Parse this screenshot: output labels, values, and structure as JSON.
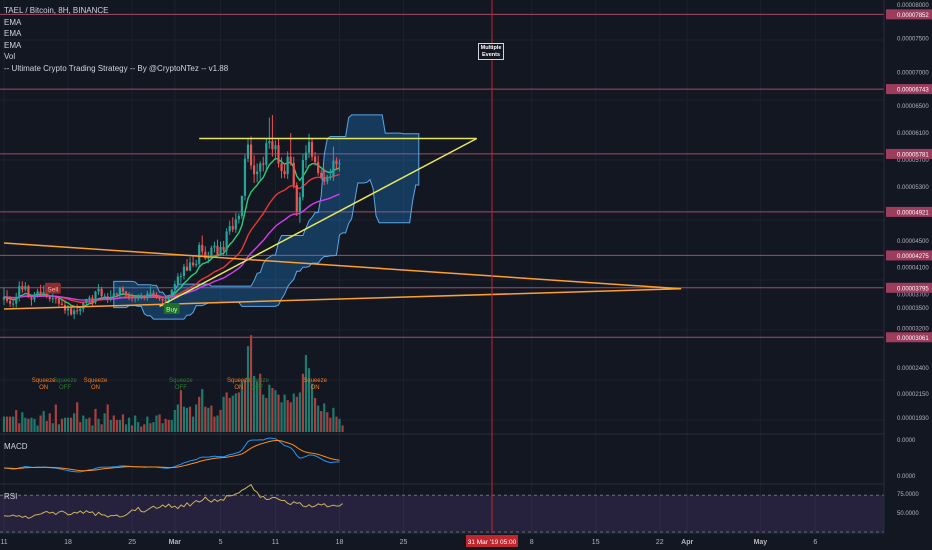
{
  "legend": {
    "symbol": "TAEL / Bitcoin, 8H, BINANCE",
    "indicators": [
      "EMA",
      "EMA",
      "EMA",
      "Vol",
      "-- Ultimate Crypto Trading Strategy -- By @CryptoNTez -- v1.88"
    ]
  },
  "events_badge": "Multiple Events",
  "panes": {
    "macd": "MACD",
    "rsi": "RSI"
  },
  "x_ticks": [
    {
      "label": "11",
      "i": 0
    },
    {
      "label": "18",
      "i": 21
    },
    {
      "label": "25",
      "i": 42
    },
    {
      "label": "Mar",
      "i": 56
    },
    {
      "label": "5",
      "i": 71
    },
    {
      "label": "11",
      "i": 89
    },
    {
      "label": "18",
      "i": 110
    },
    {
      "label": "25",
      "i": 131
    },
    {
      "label": "8",
      "i": 173
    },
    {
      "label": "15",
      "i": 194
    },
    {
      "label": "22",
      "i": 215
    },
    {
      "label": "Apr",
      "i": 224
    },
    {
      "label": "May",
      "i": 248
    },
    {
      "label": "6",
      "i": 266
    }
  ],
  "crosshair_label": "31 Mar '19 05:00",
  "chart_data": {
    "type": "candlestick",
    "symbol": "TAEL/BTC",
    "interval": "8H",
    "exchange": "BINANCE",
    "price_axis_ticks": [
      "0.00008000",
      "0.00007500",
      "0.00007000",
      "0.00006500",
      "0.00006100",
      "0.00005700",
      "0.00005300",
      "0.00004900",
      "0.00004500",
      "0.00004100",
      "0.00003700",
      "0.00003500",
      "0.00003200",
      "0.00002900",
      "0.00002650",
      "0.00002400",
      "0.00002150",
      "0.00001930"
    ],
    "horizontal_levels": [
      "0.00007852",
      "0.00006743",
      "0.00005781",
      "0.00004921",
      "0.00004275",
      "0.00003795",
      "0.00003061"
    ],
    "ylim": [
      3.05e-05,
      8.05e-05
    ],
    "trend_lines": [
      {
        "color": "#e6e65c",
        "from": [
          51,
          3.52e-05
        ],
        "to": [
          155,
          6.01e-05
        ]
      },
      {
        "color": "#e6e65c",
        "from": [
          64,
          6.01e-05
        ],
        "to": [
          155,
          6.01e-05
        ]
      },
      {
        "color": "#ff9f2e",
        "from": [
          0,
          4.46e-05
        ],
        "to": [
          222,
          3.78e-05
        ]
      },
      {
        "color": "#ff9f2e",
        "from": [
          0,
          3.48e-05
        ],
        "to": [
          222,
          3.78e-05
        ]
      }
    ],
    "signals": [
      {
        "label": "Sell",
        "i": 16,
        "price": 3.78e-05
      },
      {
        "label": "Buy",
        "i": 55,
        "price": 3.48e-05
      }
    ],
    "squeeze_labels": [
      {
        "text": "Squeeze ON",
        "i": 13
      },
      {
        "text": "Squeeze OFF",
        "i": 20
      },
      {
        "text": "Squeeze ON",
        "i": 30
      },
      {
        "text": "Squeeze OFF",
        "i": 58
      },
      {
        "text": "Squeeze ON",
        "i": 77
      },
      {
        "text": "Squeeze OFF",
        "i": 83
      },
      {
        "text": "Squeeze ON",
        "i": 102
      }
    ],
    "candles": [
      [
        3.62e-05,
        3.79e-05,
        3.54e-05,
        3.66e-05
      ],
      [
        3.66e-05,
        3.76e-05,
        3.57e-05,
        3.6e-05
      ],
      [
        3.6e-05,
        3.67e-05,
        3.51e-05,
        3.56e-05
      ],
      [
        3.56e-05,
        3.63e-05,
        3.5e-05,
        3.56e-05
      ],
      [
        3.56e-05,
        3.72e-05,
        3.5e-05,
        3.66e-05
      ],
      [
        3.66e-05,
        3.89e-05,
        3.59e-05,
        3.82e-05
      ],
      [
        3.82e-05,
        3.89e-05,
        3.72e-05,
        3.77e-05
      ],
      [
        3.77e-05,
        3.88e-05,
        3.74e-05,
        3.82e-05
      ],
      [
        3.82e-05,
        3.84e-05,
        3.65e-05,
        3.65e-05
      ],
      [
        3.65e-05,
        3.69e-05,
        3.53e-05,
        3.62e-05
      ],
      [
        3.62e-05,
        3.73e-05,
        3.58e-05,
        3.69e-05
      ],
      [
        3.69e-05,
        3.78e-05,
        3.65e-05,
        3.74e-05
      ],
      [
        3.74e-05,
        3.84e-05,
        3.67e-05,
        3.68e-05
      ],
      [
        3.68e-05,
        3.83e-05,
        3.66e-05,
        3.73e-05
      ],
      [
        3.73e-05,
        3.83e-05,
        3.64e-05,
        3.66e-05
      ],
      [
        3.66e-05,
        3.67e-05,
        3.59e-05,
        3.63e-05
      ],
      [
        3.63e-05,
        3.73e-05,
        3.57e-05,
        3.64e-05
      ],
      [
        3.64e-05,
        3.67e-05,
        3.56e-05,
        3.63e-05
      ],
      [
        3.63e-05,
        3.66e-05,
        3.52e-05,
        3.56e-05
      ],
      [
        3.56e-05,
        3.64e-05,
        3.53e-05,
        3.54e-05
      ],
      [
        3.54e-05,
        3.61e-05,
        3.41e-05,
        3.46e-05
      ],
      [
        3.46e-05,
        3.54e-05,
        3.38e-05,
        3.49e-05
      ],
      [
        3.49e-05,
        3.52e-05,
        3.38e-05,
        3.4e-05
      ],
      [
        3.4e-05,
        3.49e-05,
        3.33e-05,
        3.46e-05
      ],
      [
        3.46e-05,
        3.55e-05,
        3.4e-05,
        3.45e-05
      ],
      [
        3.45e-05,
        3.51e-05,
        3.39e-05,
        3.48e-05
      ],
      [
        3.48e-05,
        3.59e-05,
        3.43e-05,
        3.57e-05
      ],
      [
        3.57e-05,
        3.63e-05,
        3.54e-05,
        3.63e-05
      ],
      [
        3.63e-05,
        3.68e-05,
        3.55e-05,
        3.65e-05
      ],
      [
        3.65e-05,
        3.69e-05,
        3.53e-05,
        3.58e-05
      ],
      [
        3.58e-05,
        3.75e-05,
        3.55e-05,
        3.74e-05
      ],
      [
        3.74e-05,
        3.85e-05,
        3.69e-05,
        3.78e-05
      ],
      [
        3.78e-05,
        3.81e-05,
        3.63e-05,
        3.67e-05
      ],
      [
        3.67e-05,
        3.71e-05,
        3.63e-05,
        3.67e-05
      ],
      [
        3.67e-05,
        3.72e-05,
        3.57e-05,
        3.65e-05
      ],
      [
        3.65e-05,
        3.76e-05,
        3.59e-05,
        3.65e-05
      ],
      [
        3.65e-05,
        3.75e-05,
        3.61e-05,
        3.71e-05
      ],
      [
        3.71e-05,
        3.72e-05,
        3.66e-05,
        3.7e-05
      ],
      [
        3.7e-05,
        3.81e-05,
        3.65e-05,
        3.79e-05
      ],
      [
        3.79e-05,
        3.82e-05,
        3.71e-05,
        3.74e-05
      ],
      [
        3.74e-05,
        3.75e-05,
        3.66e-05,
        3.68e-05
      ],
      [
        3.68e-05,
        3.73e-05,
        3.61e-05,
        3.66e-05
      ],
      [
        3.66e-05,
        3.71e-05,
        3.59e-05,
        3.64e-05
      ],
      [
        3.64e-05,
        3.68e-05,
        3.58e-05,
        3.66e-05
      ],
      [
        3.66e-05,
        3.7e-05,
        3.6e-05,
        3.66e-05
      ],
      [
        3.66e-05,
        3.72e-05,
        3.62e-05,
        3.68e-05
      ],
      [
        3.68e-05,
        3.69e-05,
        3.61e-05,
        3.64e-05
      ],
      [
        3.64e-05,
        3.75e-05,
        3.6e-05,
        3.71e-05
      ],
      [
        3.71e-05,
        3.82e-05,
        3.66e-05,
        3.72e-05
      ],
      [
        3.72e-05,
        3.76e-05,
        3.65e-05,
        3.69e-05
      ],
      [
        3.69e-05,
        3.73e-05,
        3.63e-05,
        3.66e-05
      ],
      [
        3.66e-05,
        3.67e-05,
        3.6e-05,
        3.63e-05
      ],
      [
        3.63e-05,
        3.64e-05,
        3.52e-05,
        3.61e-05
      ],
      [
        3.61e-05,
        3.65e-05,
        3.52e-05,
        3.59e-05
      ],
      [
        3.59e-05,
        3.69e-05,
        3.54e-05,
        3.67e-05
      ],
      [
        3.67e-05,
        3.77e-05,
        3.63e-05,
        3.77e-05
      ],
      [
        3.77e-05,
        3.9e-05,
        3.7e-05,
        3.85e-05
      ],
      [
        3.85e-05,
        4.01e-05,
        3.81e-05,
        3.96e-05
      ],
      [
        3.96e-05,
        4.02e-05,
        3.87e-05,
        3.97e-05
      ],
      [
        3.97e-05,
        4.15e-05,
        3.92e-05,
        4.11e-05
      ],
      [
        4.11e-05,
        4.22e-05,
        4.04e-05,
        4.05e-05
      ],
      [
        4.05e-05,
        4.25e-05,
        4.04e-05,
        4.17e-05
      ],
      [
        4.17e-05,
        4.28e-05,
        4.1e-05,
        4.13e-05
      ],
      [
        4.13e-05,
        4.21e-05,
        4.1e-05,
        4.15e-05
      ],
      [
        4.15e-05,
        4.47e-05,
        4.11e-05,
        4.43e-05
      ],
      [
        4.43e-05,
        4.57e-05,
        4.28e-05,
        4.33e-05
      ],
      [
        4.33e-05,
        4.41e-05,
        4.21e-05,
        4.23e-05
      ],
      [
        4.23e-05,
        4.33e-05,
        4.16e-05,
        4.26e-05
      ],
      [
        4.26e-05,
        4.42e-05,
        4.22e-05,
        4.39e-05
      ],
      [
        4.39e-05,
        4.48e-05,
        4.32e-05,
        4.42e-05
      ],
      [
        4.42e-05,
        4.51e-05,
        4.26e-05,
        4.28e-05
      ],
      [
        4.28e-05,
        4.48e-05,
        4.27e-05,
        4.4e-05
      ],
      [
        4.4e-05,
        4.49e-05,
        4.27e-05,
        4.35e-05
      ],
      [
        4.35e-05,
        4.68e-05,
        4.28e-05,
        4.63e-05
      ],
      [
        4.63e-05,
        4.79e-05,
        4.58e-05,
        4.71e-05
      ],
      [
        4.71e-05,
        4.84e-05,
        4.62e-05,
        4.66e-05
      ],
      [
        4.66e-05,
        4.91e-05,
        4.61e-05,
        4.81e-05
      ],
      [
        4.81e-05,
        4.9e-05,
        4.75e-05,
        4.86e-05
      ],
      [
        4.86e-05,
        5.16e-05,
        4.82e-05,
        5.16e-05
      ],
      [
        5.16e-05,
        5.77e-05,
        5.09e-05,
        5.71e-05
      ],
      [
        5.71e-05,
        6.01e-05,
        5.66e-05,
        5.92e-05
      ],
      [
        5.92e-05,
        6.04e-05,
        5.55e-05,
        5.61e-05
      ],
      [
        5.61e-05,
        5.76e-05,
        5.35e-05,
        5.48e-05
      ],
      [
        5.48e-05,
        5.64e-05,
        5.36e-05,
        5.52e-05
      ],
      [
        5.52e-05,
        5.67e-05,
        5.4e-05,
        5.64e-05
      ],
      [
        5.64e-05,
        5.74e-05,
        5.52e-05,
        5.62e-05
      ],
      [
        5.62e-05,
        6.01e-05,
        5.54e-05,
        5.94e-05
      ],
      [
        5.94e-05,
        6.32e-05,
        5.86e-05,
        5.97e-05
      ],
      [
        5.97e-05,
        6.36e-05,
        5.74e-05,
        5.85e-05
      ],
      [
        5.85e-05,
        5.98e-05,
        5.69e-05,
        5.91e-05
      ],
      [
        5.91e-05,
        6.01e-05,
        5.58e-05,
        5.64e-05
      ],
      [
        5.64e-05,
        5.73e-05,
        5.42e-05,
        5.53e-05
      ],
      [
        5.53e-05,
        5.63e-05,
        5.42e-05,
        5.48e-05
      ],
      [
        5.48e-05,
        5.82e-05,
        5.41e-05,
        5.74e-05
      ],
      [
        5.74e-05,
        6.09e-05,
        5.61e-05,
        5.65e-05
      ],
      [
        5.65e-05,
        5.74e-05,
        5.27e-05,
        5.32e-05
      ],
      [
        5.32e-05,
        5.36e-05,
        4.86e-05,
        4.92e-05
      ],
      [
        4.92e-05,
        5.21e-05,
        4.76e-05,
        5.14e-05
      ],
      [
        5.14e-05,
        5.78e-05,
        5.09e-05,
        5.69e-05
      ],
      [
        5.69e-05,
        5.91e-05,
        5.57e-05,
        5.8e-05
      ],
      [
        5.8e-05,
        6.08e-05,
        5.72e-05,
        5.96e-05
      ],
      [
        5.96e-05,
        6.02e-05,
        5.68e-05,
        5.74e-05
      ],
      [
        5.74e-05,
        5.81e-05,
        5.61e-05,
        5.66e-05
      ],
      [
        5.66e-05,
        5.76e-05,
        5.46e-05,
        5.5e-05
      ],
      [
        5.5e-05,
        5.55e-05,
        5.4e-05,
        5.43e-05
      ],
      [
        5.43e-05,
        5.56e-05,
        5.32e-05,
        5.37e-05
      ],
      [
        5.37e-05,
        5.47e-05,
        5.33e-05,
        5.44e-05
      ],
      [
        5.44e-05,
        5.56e-05,
        5.39e-05,
        5.45e-05
      ],
      [
        5.45e-05,
        5.89e-05,
        5.38e-05,
        5.68e-05
      ],
      [
        5.68e-05,
        5.73e-05,
        5.54e-05,
        5.63e-05
      ],
      [
        5.63e-05,
        5.7e-05,
        5.52e-05,
        5.64e-05
      ]
    ],
    "volume": [
      [
        1.4,
        1
      ],
      [
        1.4,
        0
      ],
      [
        1.4,
        0
      ],
      [
        1.4,
        1
      ],
      [
        2.0,
        0
      ],
      [
        0.8,
        0
      ],
      [
        1.8,
        1
      ],
      [
        1.3,
        1
      ],
      [
        1.2,
        0
      ],
      [
        1.3,
        1
      ],
      [
        1.2,
        1
      ],
      [
        0.6,
        1
      ],
      [
        1.5,
        0
      ],
      [
        1.9,
        1
      ],
      [
        1.0,
        0
      ],
      [
        1.7,
        0
      ],
      [
        0.8,
        1
      ],
      [
        2.5,
        0
      ],
      [
        0.7,
        1
      ],
      [
        1.2,
        0
      ],
      [
        1.3,
        1
      ],
      [
        1.3,
        1
      ],
      [
        1.3,
        0
      ],
      [
        1.7,
        1
      ],
      [
        2.7,
        0
      ],
      [
        0.9,
        0
      ],
      [
        1.5,
        1
      ],
      [
        1.2,
        1
      ],
      [
        1.3,
        0
      ],
      [
        0.6,
        1
      ],
      [
        2.1,
        0
      ],
      [
        1.2,
        1
      ],
      [
        0.7,
        0
      ],
      [
        1.7,
        1
      ],
      [
        2.5,
        0
      ],
      [
        1.1,
        1
      ],
      [
        1.5,
        0
      ],
      [
        1.1,
        0
      ],
      [
        1.1,
        1
      ],
      [
        1.6,
        0
      ],
      [
        0.7,
        1
      ],
      [
        1.3,
        1
      ],
      [
        0.6,
        0
      ],
      [
        1.5,
        1
      ],
      [
        0.9,
        1
      ],
      [
        0.5,
        0
      ],
      [
        0.7,
        0
      ],
      [
        1.4,
        1
      ],
      [
        0.8,
        0
      ],
      [
        0.9,
        1
      ],
      [
        1.5,
        1
      ],
      [
        1.6,
        0
      ],
      [
        0.8,
        1
      ],
      [
        1.2,
        0
      ],
      [
        1.1,
        0
      ],
      [
        1.1,
        1
      ],
      [
        2.0,
        1
      ],
      [
        2.5,
        1
      ],
      [
        3.8,
        0
      ],
      [
        2.3,
        1
      ],
      [
        2.2,
        1
      ],
      [
        2.3,
        0
      ],
      [
        1.4,
        1
      ],
      [
        2.5,
        1
      ],
      [
        3.2,
        0
      ],
      [
        3.9,
        1
      ],
      [
        2.3,
        0
      ],
      [
        2.2,
        1
      ],
      [
        2.4,
        0
      ],
      [
        1.4,
        0
      ],
      [
        1.5,
        1
      ],
      [
        2.0,
        0
      ],
      [
        3.2,
        1
      ],
      [
        3.6,
        0
      ],
      [
        3.1,
        0
      ],
      [
        3.3,
        1
      ],
      [
        3.5,
        1
      ],
      [
        3.6,
        0
      ],
      [
        4.6,
        1
      ],
      [
        4.8,
        0
      ],
      [
        7.8,
        1
      ],
      [
        8.8,
        0
      ],
      [
        5.1,
        1
      ],
      [
        4.6,
        1
      ],
      [
        5.3,
        0
      ],
      [
        3.4,
        1
      ],
      [
        3.1,
        0
      ],
      [
        4.3,
        1
      ],
      [
        4.0,
        0
      ],
      [
        3.8,
        1
      ],
      [
        3.4,
        0
      ],
      [
        2.7,
        1
      ],
      [
        3.4,
        1
      ],
      [
        2.9,
        0
      ],
      [
        2.7,
        0
      ],
      [
        3.5,
        1
      ],
      [
        3.2,
        0
      ],
      [
        3.6,
        1
      ],
      [
        5.3,
        0
      ],
      [
        7.0,
        1
      ],
      [
        5.8,
        1
      ],
      [
        4.4,
        1
      ],
      [
        3.1,
        0
      ],
      [
        2.4,
        1
      ],
      [
        1.9,
        0
      ],
      [
        2.6,
        1
      ],
      [
        1.8,
        0
      ],
      [
        1.3,
        0
      ],
      [
        2.2,
        1
      ],
      [
        1.4,
        0
      ],
      [
        1.2,
        1
      ],
      [
        0.6,
        0
      ]
    ],
    "volume_axis_ticks": [
      "0.00002400",
      "0.00002150",
      "0.00001930"
    ],
    "macd": {
      "label": "MACD",
      "axis_ticks": [
        "0.0000",
        "0.0000"
      ],
      "series": [
        "MACD",
        "Signal"
      ]
    },
    "rsi": {
      "label": "RSI",
      "axis_ticks": [
        "75.0000",
        "50.0000"
      ],
      "levels": [
        70,
        30
      ],
      "ylim": [
        30,
        80
      ],
      "values": [
        47.7,
        47.3,
        47.4,
        48.4,
        47.0,
        47.8,
        45.8,
        47.3,
        44.9,
        46.1,
        48.3,
        48.9,
        49.5,
        51.2,
        52.4,
        50.5,
        51.5,
        49.0,
        51.7,
        52.8,
        51.3,
        48.7,
        49.1,
        51.4,
        50.6,
        52.8,
        50.3,
        53.1,
        51.1,
        51.9,
        47.9,
        51.4,
        48.8,
        48.5,
        46.3,
        47.8,
        47.8,
        48.4,
        46.3,
        46.9,
        48.4,
        51.0,
        54.0,
        53.3,
        56.7,
        52.3,
        51.8,
        53.9,
        56.1,
        58.0,
        55.7,
        56.7,
        59.4,
        57.2,
        60.3,
        56.7,
        58.1,
        55.4,
        59.3,
        57.5,
        61.7,
        58.2,
        61.7,
        64.2,
        62.6,
        64.3,
        67.9,
        64.5,
        62.5,
        65.6,
        63.2,
        65.3,
        64.5,
        69.6,
        69.2,
        69.8,
        71.5,
        72.5,
        75.4,
        77.0,
        79.4,
        81.4,
        75.5,
        73.2,
        67.7,
        68.7,
        65.3,
        65.6,
        67.6,
        67.4,
        65.6,
        64.2,
        64.2,
        61.2,
        59.8,
        62.9,
        61.2,
        61.9,
        58.2,
        57.3,
        59.6,
        57.2,
        58.1,
        60.6,
        59.4,
        60.7,
        57.4,
        58.2,
        59.2,
        58.2,
        58.3,
        60.9
      ]
    }
  }
}
